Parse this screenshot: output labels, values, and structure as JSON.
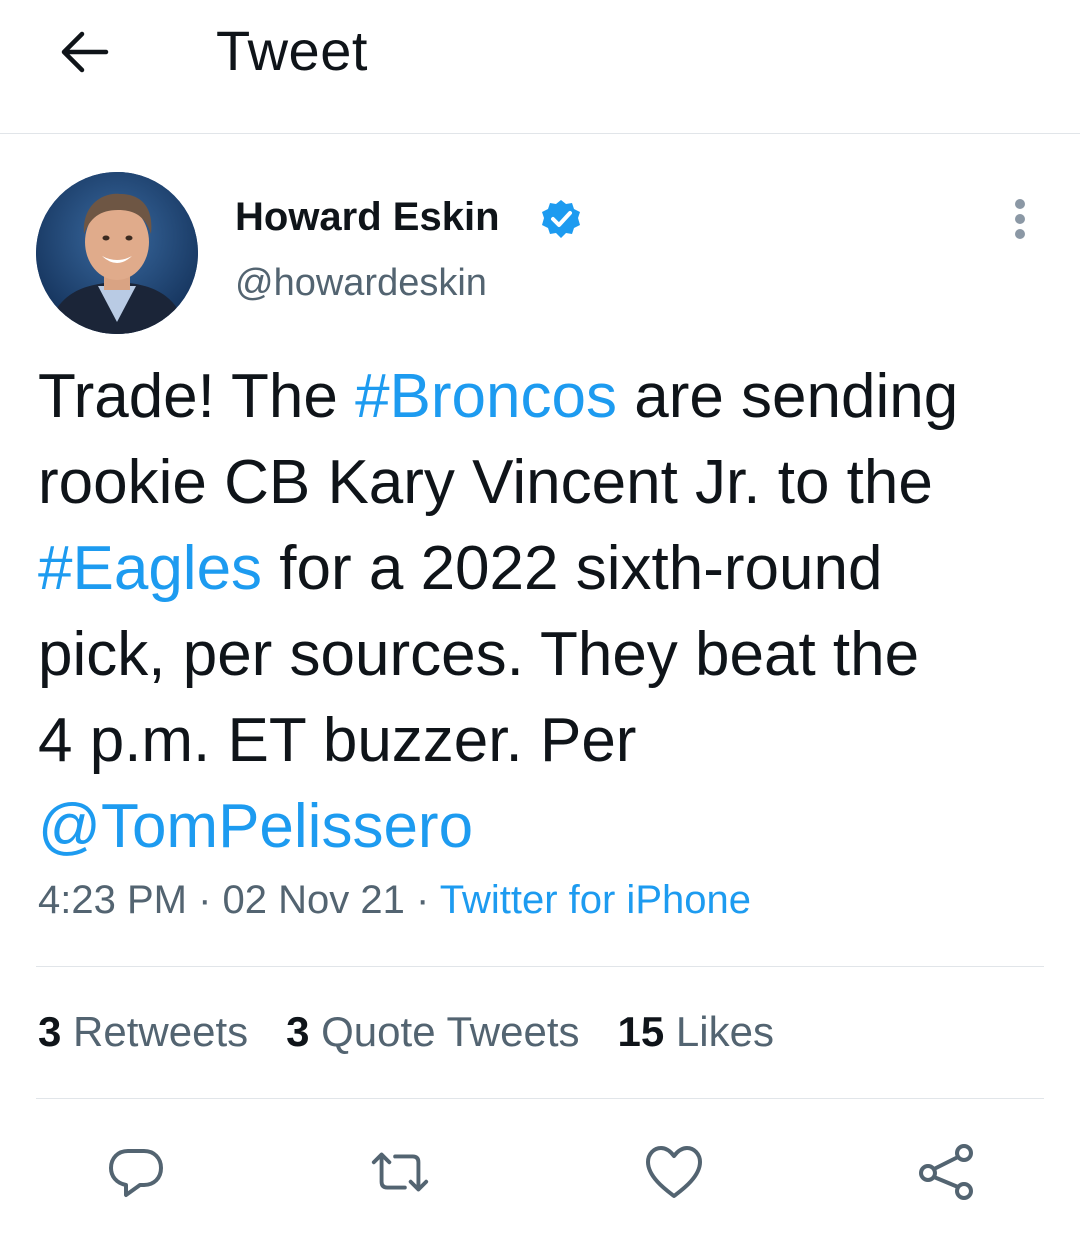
{
  "header": {
    "title": "Tweet",
    "back_icon": "arrow-left-icon"
  },
  "author": {
    "name": "Howard Eskin",
    "handle": "@howardeskin",
    "verified_icon": "verified-badge-icon",
    "more_icon": "more-vertical-icon"
  },
  "tweet": {
    "text_lines": [
      {
        "before": "Trade! The ",
        "link": "#Broncos",
        "after": " are sending"
      },
      {
        "text": "rookie CB Kary Vincent Jr. to the"
      },
      {
        "link": "#Eagles",
        "after": " for a 2022 sixth-round"
      },
      {
        "text": "pick, per sources. They beat the"
      },
      {
        "text": "4 p.m. ET buzzer. Per"
      },
      {
        "link": "@TomPelissero"
      }
    ],
    "time": "4:23 PM",
    "separator": "·",
    "date": "02 Nov 21",
    "source": "Twitter for iPhone"
  },
  "stats": {
    "retweets_count": "3",
    "retweets_label": "Retweets",
    "quotes_count": "3",
    "quotes_label": "Quote Tweets",
    "likes_count": "15",
    "likes_label": "Likes"
  },
  "actions": [
    {
      "icon": "reply-icon"
    },
    {
      "icon": "retweet-icon"
    },
    {
      "icon": "like-icon"
    },
    {
      "icon": "share-icon"
    }
  ],
  "colors": {
    "link": "#1d9bf0",
    "text": "#0f1419",
    "secondary": "#536471",
    "divider": "#e1e5e9"
  }
}
